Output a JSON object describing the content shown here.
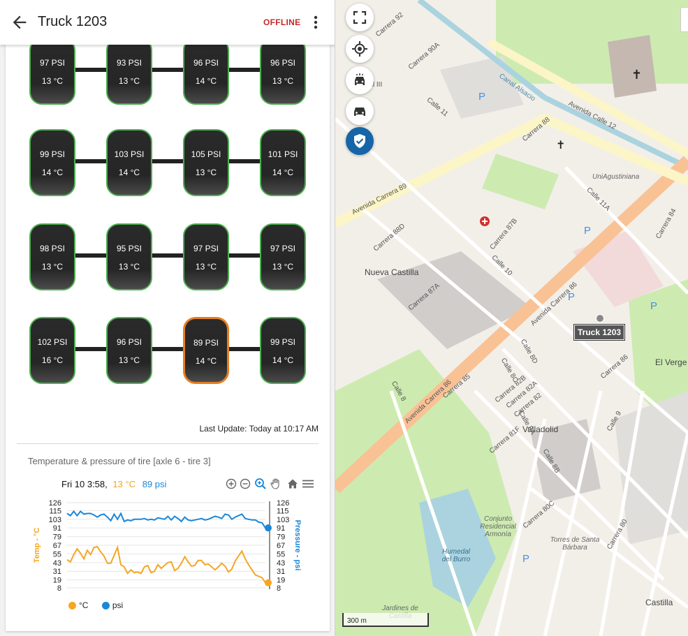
{
  "header": {
    "title": "Truck 1203",
    "status": "OFFLINE"
  },
  "axles": [
    {
      "tires": [
        {
          "psi": "97 PSI",
          "temp": "13 °C"
        },
        {
          "psi": "93 PSI",
          "temp": "13 °C"
        },
        {
          "psi": "96 PSI",
          "temp": "14 °C"
        },
        {
          "psi": "96 PSI",
          "temp": "13 °C"
        }
      ]
    },
    {
      "tires": [
        {
          "psi": "99 PSI",
          "temp": "14 °C"
        },
        {
          "psi": "103 PSI",
          "temp": "14 °C"
        },
        {
          "psi": "105 PSI",
          "temp": "13 °C"
        },
        {
          "psi": "101 PSI",
          "temp": "14 °C"
        }
      ]
    },
    {
      "tires": [
        {
          "psi": "98 PSI",
          "temp": "13 °C"
        },
        {
          "psi": "95 PSI",
          "temp": "13 °C"
        },
        {
          "psi": "97 PSI",
          "temp": "13 °C"
        },
        {
          "psi": "97 PSI",
          "temp": "13 °C"
        }
      ]
    },
    {
      "tires": [
        {
          "psi": "102 PSI",
          "temp": "16 °C"
        },
        {
          "psi": "96 PSI",
          "temp": "13 °C"
        },
        {
          "psi": "89 PSI",
          "temp": "14 °C",
          "alert": true
        },
        {
          "psi": "99 PSI",
          "temp": "14 °C"
        }
      ]
    }
  ],
  "last_update": "Last Update: Today at 10:17 AM",
  "chart_section": {
    "title": "Temperature & pressure of tire [axle 6 - tire 3]",
    "tooltip": {
      "date": "Fri 10 3:58,",
      "temp": "13 °C",
      "psi": "89 psi"
    },
    "toolbar": [
      "zoom-in",
      "zoom-out",
      "selection-zoom",
      "pan",
      "reset-home",
      "menu"
    ]
  },
  "chart_data": {
    "type": "line",
    "yaxis_left": {
      "label": "Temp - °C",
      "ticks": [
        126,
        115,
        103,
        91,
        79,
        67,
        55,
        43,
        31,
        19,
        8
      ],
      "range": [
        8,
        126
      ]
    },
    "yaxis_right": {
      "label": "Pressure - psi",
      "ticks": [
        126,
        115,
        103,
        91,
        79,
        67,
        55,
        43,
        31,
        19,
        8
      ],
      "range": [
        8,
        126
      ]
    },
    "colors": {
      "temp": "#f5a623",
      "psi": "#1a87d8"
    },
    "series": [
      {
        "name": "°C",
        "values": [
          47,
          44,
          54,
          62,
          56,
          48,
          60,
          54,
          64,
          65,
          58,
          52,
          42,
          42,
          53,
          64,
          40,
          37,
          28,
          33,
          29,
          30,
          28,
          37,
          39,
          29,
          31,
          40,
          35,
          39,
          43,
          44,
          32,
          35,
          42,
          51,
          44,
          38,
          39,
          46,
          46,
          40,
          41,
          37,
          33,
          37,
          42,
          38,
          30,
          34,
          45,
          52,
          59,
          48,
          40,
          33,
          26,
          24,
          22,
          15
        ]
      },
      {
        "name": "psi",
        "values": [
          111,
          108,
          114,
          108,
          114,
          110,
          111,
          111,
          109,
          106,
          109,
          110,
          106,
          101,
          110,
          103,
          111,
          100,
          102,
          101,
          103,
          103,
          103,
          104,
          102,
          103,
          102,
          105,
          104,
          103,
          107,
          102,
          107,
          104,
          100,
          106,
          102,
          101,
          102,
          103,
          104,
          102,
          103,
          105,
          107,
          106,
          104,
          110,
          109,
          103,
          106,
          108,
          110,
          104,
          103,
          102,
          102,
          99,
          98,
          91
        ]
      }
    ],
    "legend": [
      "°C",
      "psi"
    ]
  },
  "map": {
    "truck_label": "Truck 1203",
    "scale": "300 m",
    "labels": [
      "Avenida Calle 12",
      "Avenida Carrera 89",
      "Avenida Carrera 86",
      "Nueva Castilla",
      "Valladolid",
      "El Verge",
      "UniAgustiniana",
      "Conjunto Residencial Armonía",
      "Humedal del Burro",
      "Torres de Santa Bárbara",
      "Jardines de Castilla",
      "Castilla",
      "Calle 10",
      "Calle 11",
      "Calle 11A",
      "Calle 8",
      "Calle 8A",
      "Calle 8B",
      "Calle 8C",
      "Calle 8D",
      "Calle 9",
      "Carrera 92",
      "Carrera 90A",
      "Carrera 88",
      "Carrera 88D",
      "Carrera 87A",
      "Carrera 87B",
      "Carrera 86",
      "Carrera 85",
      "Carrera 84",
      "Carrera 80",
      "Carrera 80C",
      "Carrera 81F",
      "Carrera 82",
      "Carrera 82A",
      "Carrera 82B",
      "Canal Alsacio",
      "ntal III"
    ]
  }
}
